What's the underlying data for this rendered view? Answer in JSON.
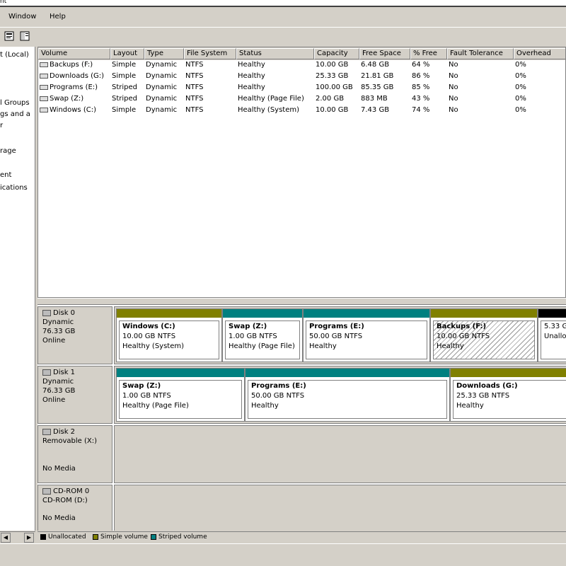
{
  "window": {
    "title_fragment": "nt"
  },
  "menu": {
    "window": "Window",
    "help": "Help"
  },
  "tree": {
    "items": [
      "t (Local)",
      "l Groups",
      "gs and a",
      "r",
      "rage",
      "ent",
      "ications"
    ]
  },
  "list": {
    "columns": [
      "Volume",
      "Layout",
      "Type",
      "File System",
      "Status",
      "Capacity",
      "Free Space",
      "% Free",
      "Fault Tolerance",
      "Overhead"
    ],
    "rows": [
      [
        "Backups (F:)",
        "Simple",
        "Dynamic",
        "NTFS",
        "Healthy",
        "10.00 GB",
        "6.48 GB",
        "64 %",
        "No",
        "0%"
      ],
      [
        "Downloads (G:)",
        "Simple",
        "Dynamic",
        "NTFS",
        "Healthy",
        "25.33 GB",
        "21.81 GB",
        "86 %",
        "No",
        "0%"
      ],
      [
        "Programs (E:)",
        "Striped",
        "Dynamic",
        "NTFS",
        "Healthy",
        "100.00 GB",
        "85.35 GB",
        "85 %",
        "No",
        "0%"
      ],
      [
        "Swap (Z:)",
        "Striped",
        "Dynamic",
        "NTFS",
        "Healthy (Page File)",
        "2.00 GB",
        "883 MB",
        "43 %",
        "No",
        "0%"
      ],
      [
        "Windows (C:)",
        "Simple",
        "Dynamic",
        "NTFS",
        "Healthy (System)",
        "10.00 GB",
        "7.43 GB",
        "74 %",
        "No",
        "0%"
      ]
    ]
  },
  "disks": [
    {
      "name": "Disk 0",
      "type": "Dynamic",
      "size": "76.33 GB",
      "state": "Online",
      "partitions": [
        {
          "name": "Windows  (C:)",
          "size": "10.00 GB NTFS",
          "status": "Healthy (System)",
          "color": "#808000"
        },
        {
          "name": "Swap  (Z:)",
          "size": "1.00 GB NTFS",
          "status": "Healthy (Page File)",
          "color": "#008080"
        },
        {
          "name": "Programs  (E:)",
          "size": "50.00 GB NTFS",
          "status": "Healthy",
          "color": "#008080"
        },
        {
          "name": "Backups  (F:)",
          "size": "10.00 GB NTFS",
          "status": "Healthy",
          "color": "#808000"
        },
        {
          "name": "",
          "size": "5.33 G",
          "status": "Unalloc",
          "color": "#000000"
        }
      ]
    },
    {
      "name": "Disk 1",
      "type": "Dynamic",
      "size": "76.33 GB",
      "state": "Online",
      "partitions": [
        {
          "name": "Swap  (Z:)",
          "size": "1.00 GB NTFS",
          "status": "Healthy (Page File)",
          "color": "#008080"
        },
        {
          "name": "Programs  (E:)",
          "size": "50.00 GB NTFS",
          "status": "Healthy",
          "color": "#008080"
        },
        {
          "name": "Downloads  (G:)",
          "size": "25.33 GB NTFS",
          "status": "Healthy",
          "color": "#808000"
        }
      ]
    },
    {
      "name": "Disk 2",
      "type": "Removable (X:)",
      "size": "",
      "state": "No Media"
    },
    {
      "name": "CD-ROM 0",
      "type": "CD-ROM (D:)",
      "size": "",
      "state": "No Media"
    }
  ],
  "legend": {
    "unallocated": "Unallocated",
    "simple": "Simple volume",
    "striped": "Striped volume",
    "colors": {
      "unallocated": "#000000",
      "simple": "#808000",
      "striped": "#008080"
    }
  }
}
